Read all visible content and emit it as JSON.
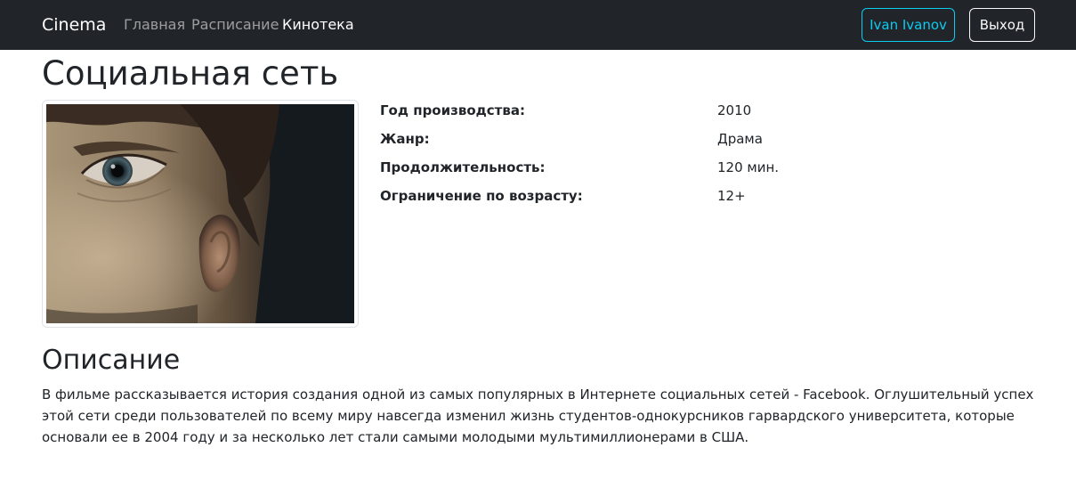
{
  "navbar": {
    "brand": "Cinema",
    "links": [
      {
        "label": "Главная"
      },
      {
        "label": "Расписание"
      },
      {
        "label": "Кинотека"
      }
    ],
    "user_button": "Ivan Ivanov",
    "logout_button": "Выход"
  },
  "movie": {
    "title": "Социальная сеть",
    "details": [
      {
        "label": "Год производства:",
        "value": "2010"
      },
      {
        "label": "Жанр:",
        "value": "Драма"
      },
      {
        "label": "Продолжительность:",
        "value": "120 мин."
      },
      {
        "label": "Ограничение по возрасту:",
        "value": "12+"
      }
    ],
    "description_title": "Описание",
    "description": "В фильме рассказывается история создания одной из самых популярных в Интернете социальных сетей - Facebook. Оглушительный успех этой сети среди пользователей по всему миру навсегда изменил жизнь студентов-однокурсников гарвардского университета, которые основали ее в 2004 году и за несколько лет стали самыми молодыми мультимиллионерами в США."
  },
  "colors": {
    "navbar_bg": "#212529",
    "user_button": "#0dcaf0",
    "text": "#212529"
  }
}
